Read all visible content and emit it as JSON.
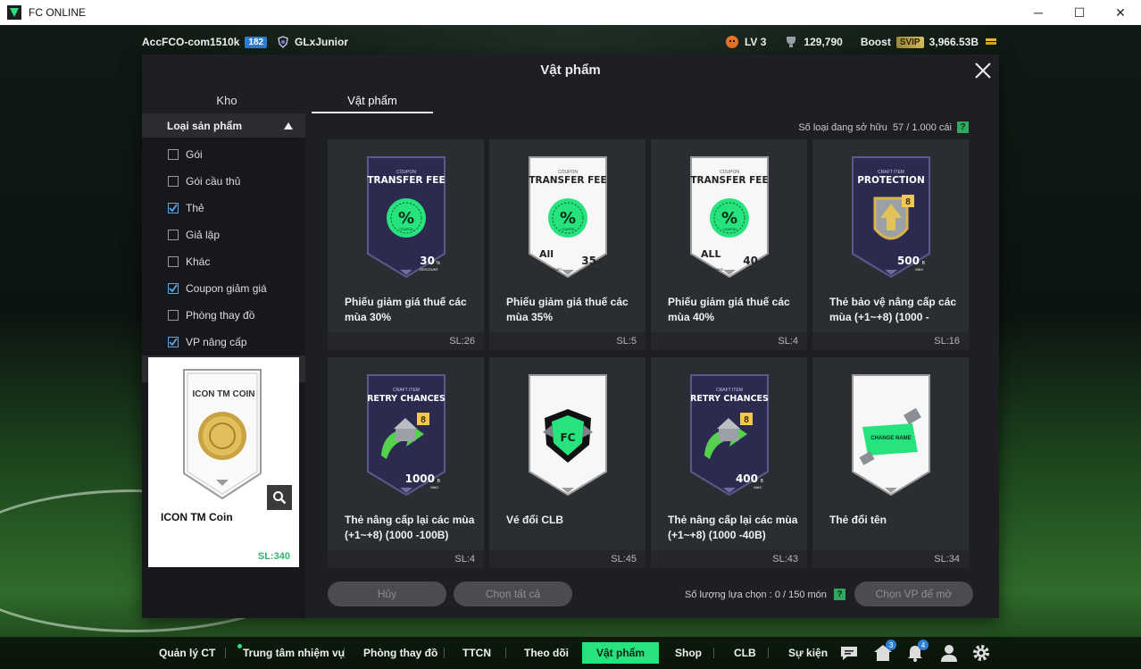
{
  "window": {
    "title": "FC ONLINE",
    "minimize": "─",
    "maximize": "☐",
    "close": "✕"
  },
  "topbar": {
    "account": "AccFCO-com1510k",
    "account_level": "182",
    "club": "GLxJunior",
    "level": "LV 3",
    "trophies": "129,790",
    "boost_label": "Boost",
    "vip": "SVIP",
    "coins": "3,966.53B"
  },
  "dialog": {
    "title": "Vật phẩm",
    "tabs": [
      {
        "label": "Kho"
      },
      {
        "label": "Vật phẩm"
      }
    ],
    "active_tab": "Vật phẩm",
    "owned_label": "Số loại đang sở hữu",
    "owned_value": "57 / 1.000 cái",
    "help": "?"
  },
  "filters": {
    "title": "Loại sản phẩm",
    "items": [
      {
        "label": "Gói",
        "checked": false
      },
      {
        "label": "Gói cầu thủ",
        "checked": false
      },
      {
        "label": "Thẻ",
        "checked": true
      },
      {
        "label": "Giả lập",
        "checked": false
      },
      {
        "label": "Khác",
        "checked": false
      },
      {
        "label": "Coupon giảm giá",
        "checked": true
      },
      {
        "label": "Phòng thay đồ",
        "checked": false
      },
      {
        "label": "VP nâng cấp",
        "checked": true
      }
    ]
  },
  "preview": {
    "card_title": "ICON TM COIN",
    "name": "ICON TM Coin",
    "count": "SL:340"
  },
  "items": [
    {
      "name": "Phiếu giảm giá thuế các mùa 30%",
      "count": "SL:26",
      "style": "dark",
      "kind": "coupon",
      "label_top": "COUPON",
      "label_main": "TRANSFER FEE",
      "value": "30",
      "unit": "%",
      "sub": "DISCOUNT",
      "corner": "",
      "corner_sub": ""
    },
    {
      "name": "Phiếu giảm giá thuế các mùa 35%",
      "count": "SL:5",
      "style": "light",
      "kind": "coupon",
      "label_top": "COUPON",
      "label_main": "TRANSFER FEE",
      "value": "35",
      "unit": "%",
      "sub": "BONUS",
      "corner": "All",
      "corner_sub": "CLASS MONEY"
    },
    {
      "name": "Phiếu giảm giá thuế các mùa 40%",
      "count": "SL:4",
      "style": "light",
      "kind": "coupon",
      "label_top": "COUPON",
      "label_main": "TRANSFER FEE",
      "value": "40",
      "unit": "%",
      "sub": "BONUS",
      "corner": "ALL",
      "corner_sub": "CLASS BONUS"
    },
    {
      "name": "Thẻ bảo vệ nâng cấp các mùa (+1~+8) (1000 -",
      "count": "SL:16",
      "style": "dark",
      "kind": "protect",
      "label_top": "CRAFT ITEM",
      "label_main": "PROTECTION",
      "value": "500",
      "unit": "B",
      "sub": "MAX",
      "corner": "",
      "corner_sub": ""
    },
    {
      "name": "Thẻ nâng cấp lại các mùa (+1~+8) (1000 -100B)",
      "count": "SL:4",
      "style": "dark",
      "kind": "retry",
      "label_top": "CRAFT ITEM",
      "label_main": "RETRY CHANCES",
      "value": "1000",
      "unit": "B",
      "sub": "MAX",
      "corner": "",
      "corner_sub": ""
    },
    {
      "name": "Vé đổi CLB",
      "count": "SL:45",
      "style": "light",
      "kind": "club",
      "label_top": "",
      "label_main": "",
      "value": "",
      "unit": "",
      "sub": "",
      "corner": "",
      "corner_sub": ""
    },
    {
      "name": "Thẻ nâng cấp lại các mùa (+1~+8) (1000 -40B)",
      "count": "SL:43",
      "style": "dark",
      "kind": "retry",
      "label_top": "CRAFT ITEM",
      "label_main": "RETRY CHANCES",
      "value": "400",
      "unit": "B",
      "sub": "MAX",
      "corner": "",
      "corner_sub": ""
    },
    {
      "name": "Thẻ đổi tên",
      "count": "SL:34",
      "style": "light",
      "kind": "rename",
      "label_top": "",
      "label_main": "",
      "value": "",
      "unit": "",
      "sub": "",
      "corner": "",
      "corner_sub": ""
    }
  ],
  "upgrade_level": "8",
  "rename_text": "CHANGE NAME",
  "actions": {
    "cancel": "Hủy",
    "select_all": "Chọn tất cả",
    "selected_label": "Số lượng lựa chọn : 0 / 150 món",
    "open": "Chọn VP để mở"
  },
  "nav": [
    {
      "label": "Quản lý CT"
    },
    {
      "label": "Trung tâm nhiệm vụ"
    },
    {
      "label": "Phòng thay đồ"
    },
    {
      "label": "TTCN"
    },
    {
      "label": "Theo dõi"
    },
    {
      "label": "Vật phẩm"
    },
    {
      "label": "Shop"
    },
    {
      "label": "CLB"
    },
    {
      "label": "Sự kiện"
    }
  ],
  "nav_badges": {
    "home": "3",
    "bell": "4"
  },
  "colors": {
    "accent": "#27e37e",
    "blue": "#2d7fd6",
    "dark_card": "#2a2d31"
  }
}
